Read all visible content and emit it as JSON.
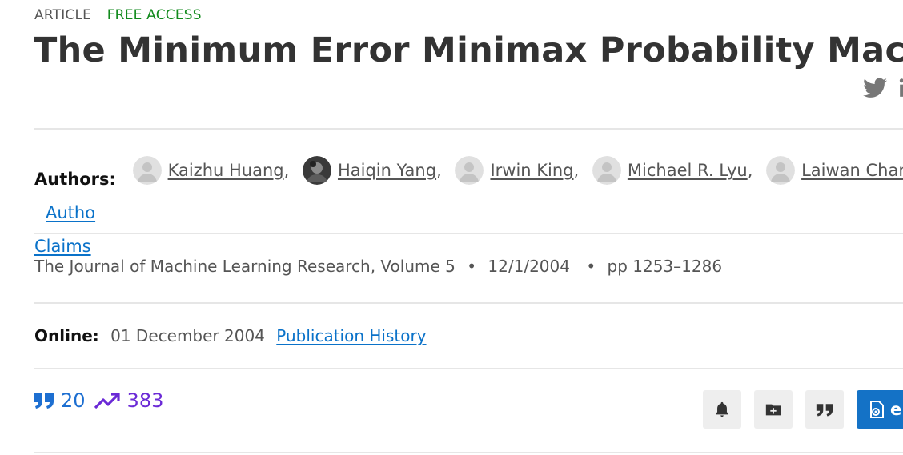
{
  "meta": {
    "type_label": "ARTICLE",
    "access_label": "FREE ACCESS"
  },
  "title": "The Minimum Error Minimax Probability Machine",
  "share": {
    "icons": [
      "twitter-icon",
      "linkedin-icon"
    ]
  },
  "authors": {
    "label": "Authors:",
    "list": [
      {
        "name": "Kaizhu Huang",
        "avatar": "placeholder"
      },
      {
        "name": "Haiqin Yang",
        "avatar": "photo"
      },
      {
        "name": "Irwin King",
        "avatar": "placeholder"
      },
      {
        "name": "Michael R. Lyu",
        "avatar": "placeholder"
      },
      {
        "name": "Laiwan Chan",
        "avatar": "placeholder"
      }
    ],
    "claims_link_part1": "Autho",
    "claims_link_part2": "Claims"
  },
  "publication": {
    "journal": "The Journal of Machine Learning Research, Volume 5",
    "date": "12/1/2004",
    "pages": "pp 1253–1286",
    "bullet": "•"
  },
  "online": {
    "label": "Online:",
    "date": "01 December 2004",
    "history_link": "Publication History"
  },
  "metrics": {
    "citations": "20",
    "downloads": "383"
  },
  "actions": {
    "alerts_icon": "bell-icon",
    "add_to_folder_icon": "folder-plus-icon",
    "cite_icon": "quote-icon",
    "ereader_label": "eRe"
  },
  "colors": {
    "free_access": "#118a1c",
    "link": "#0a72c9",
    "citation": "#1d6fd1",
    "downloads": "#6b2ad6",
    "primary_button": "#1472c6"
  }
}
